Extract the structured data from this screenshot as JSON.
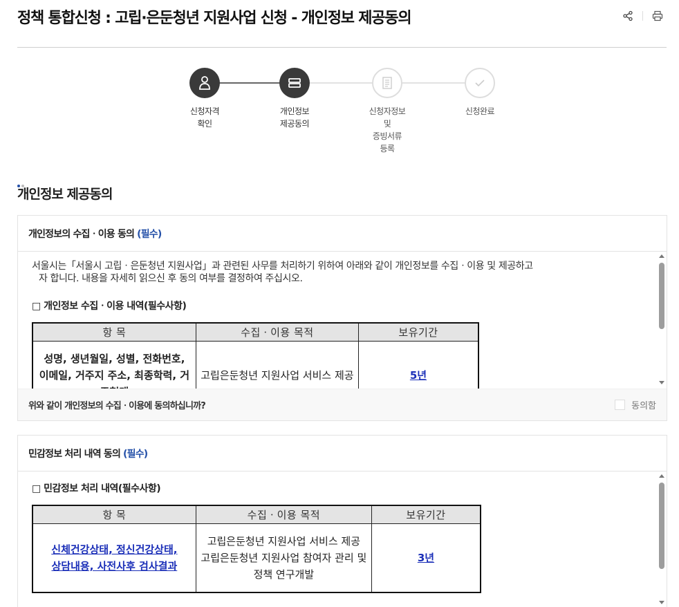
{
  "page": {
    "title": "정책 통합신청 : 고립·은둔청년 지원사업 신청 - 개인정보 제공동의"
  },
  "header_icons": [
    "share-icon",
    "print-icon"
  ],
  "colors": {
    "accent_blue": "#2450a8",
    "link_blue": "#1b2fb8",
    "step_active": "#3a3a3a",
    "step_inactive_border": "#dddddd"
  },
  "steps": [
    {
      "label": "신청자격\n확인",
      "icon": "person-icon",
      "status": "done"
    },
    {
      "label": "개인정보\n제공동의",
      "icon": "list-icon",
      "status": "current"
    },
    {
      "label": "신청자정보\n및\n증빙서류\n등록",
      "icon": "document-icon",
      "status": "todo"
    },
    {
      "label": "신청완료",
      "icon": "check-icon",
      "status": "todo"
    }
  ],
  "section_title": "개인정보 제공동의",
  "consent1": {
    "title": "개인정보의 수집ㆍ이용 동의",
    "required": "(필수)",
    "intro": "서울시는「서울시 고립ㆍ은둔청년 지원사업」과 관련된 사무를 처리하기 위하여 아래와 같이 개인정보를 수집ㆍ이용 및 제공하고",
    "intro_cont": "자 합니다. 내용을 자세히 읽으신 후 동의 여부를 결정하여 주십시오.",
    "subheading": "□ 개인정보 수집ㆍ이용 내역(필수사항)",
    "table": {
      "headers": [
        "항 목",
        "수집ㆍ이용 목적",
        "보유기간"
      ],
      "row": {
        "items": "성명, 생년월일, 성별, 전화번호, 이메일, 거주지 주소, 최종학력, 거주형태",
        "purpose": "고립은둔청년 지원사업 서비스 제공",
        "period": "5년"
      }
    },
    "question": "위와 같이 개인정보의 수집ㆍ이용에 동의하십니까?",
    "agree_label": "동의함"
  },
  "consent2": {
    "title": "민감정보 처리 내역 동의",
    "required": "(필수)",
    "subheading": "□ 민감정보 처리 내역(필수사항)",
    "table": {
      "headers": [
        "항 목",
        "수집ㆍ이용 목적",
        "보유기간"
      ],
      "row": {
        "items_line1": "신체건강상태, 정신건강상태,",
        "items_line2": "상담내용, 사전사후 검사결과",
        "purpose1": "고립은둔청년 지원사업 서비스 제공",
        "purpose2": "고립은둔청년 지원사업 참여자 관리 및 정책 연구개발",
        "period": "3년"
      }
    }
  }
}
